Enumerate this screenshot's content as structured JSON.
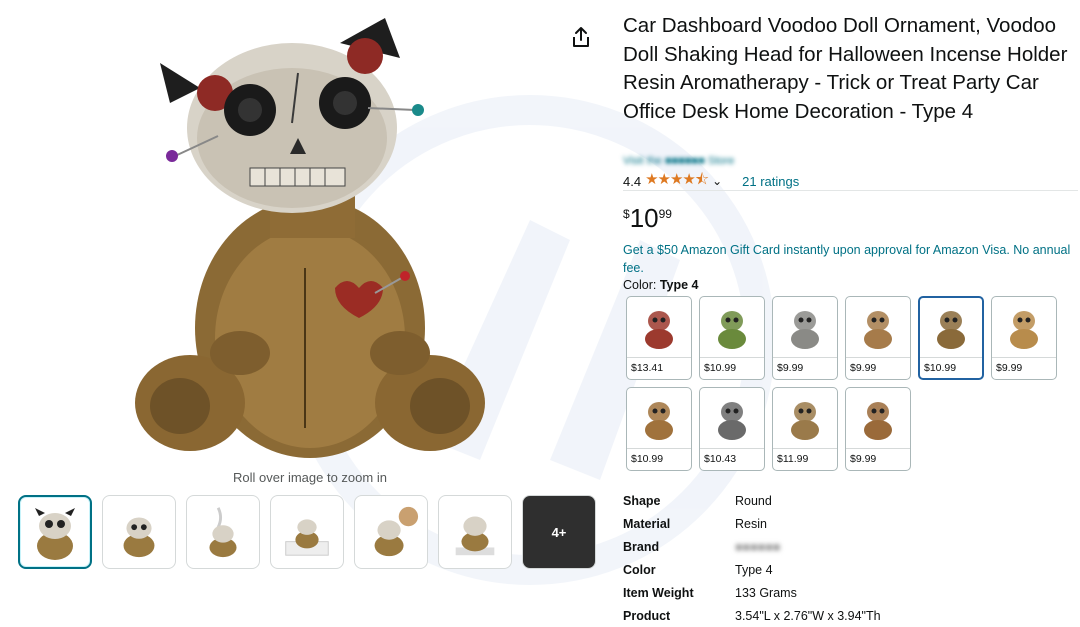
{
  "product": {
    "title": "Car Dashboard Voodoo Doll Ornament, Voodoo Doll Shaking Head for Halloween Incense Holder Resin Aromatherapy - Trick or Treat Party Car Office Desk Home Decoration - Type 4",
    "rating_value": "4.4",
    "ratings_count": "21 ratings",
    "price_symbol": "$",
    "price_whole": "10",
    "price_fraction": "99",
    "promo_text": "Get a $50 Amazon Gift Card instantly upon approval for Amazon Visa. No annual fee.",
    "color_label": "Color:",
    "color_value": "Type 4"
  },
  "image": {
    "zoom_hint": "Roll over image to zoom in",
    "more_thumbs_label": "4+"
  },
  "swatches": [
    {
      "price": "$13.41",
      "tone": "#9c3a2e"
    },
    {
      "price": "$10.99",
      "tone": "#6a8a3c"
    },
    {
      "price": "$9.99",
      "tone": "#8a8a86"
    },
    {
      "price": "$9.99",
      "tone": "#a67b4a"
    },
    {
      "price": "$10.99",
      "tone": "#8a6a3a",
      "selected": true
    },
    {
      "price": "$9.99",
      "tone": "#b88c4c"
    },
    {
      "price": "$10.99",
      "tone": "#a0723c"
    },
    {
      "price": "$10.43",
      "tone": "#6a6a6a"
    },
    {
      "price": "$11.99",
      "tone": "#9a7a4a"
    },
    {
      "price": "$9.99",
      "tone": "#9a6a3a"
    }
  ],
  "specs": [
    {
      "key": "Shape",
      "value": "Round"
    },
    {
      "key": "Material",
      "value": "Resin"
    },
    {
      "key": "Brand",
      "value": "",
      "blurred": true
    },
    {
      "key": "Color",
      "value": "Type 4"
    },
    {
      "key": "Item Weight",
      "value": "133 Grams"
    },
    {
      "key": "Product",
      "value": "3.54\"L x 2.76\"W x 3.94\"Th"
    }
  ],
  "colors": {
    "link": "#007185",
    "star": "#de7921",
    "selected_border": "#2162a1",
    "thumb_selected": "#007185"
  }
}
